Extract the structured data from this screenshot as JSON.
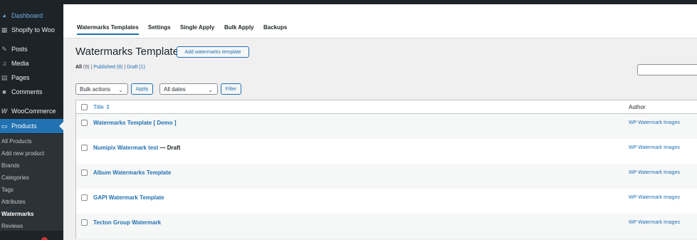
{
  "sidebar": {
    "menu": [
      {
        "label": "Dashboard",
        "icon": "dashboard-icon"
      },
      {
        "label": "Shopify to Woo",
        "icon": "store-icon"
      },
      {
        "label": "Posts",
        "icon": "pin-icon"
      },
      {
        "label": "Media",
        "icon": "media-icon"
      },
      {
        "label": "Pages",
        "icon": "page-icon"
      },
      {
        "label": "Comments",
        "icon": "comment-icon"
      },
      {
        "label": "WooCommerce",
        "icon": "woo-icon"
      },
      {
        "label": "Products",
        "icon": "archive-icon"
      }
    ],
    "submenu": [
      "All Products",
      "Add new product",
      "Brands",
      "Categories",
      "Tags",
      "Attributes",
      "Watermarks",
      "Reviews"
    ]
  },
  "tabs": [
    "Watermarks Templates",
    "Settings",
    "Single Apply",
    "Bulk Apply",
    "Backups"
  ],
  "page": {
    "title": "Watermarks Templates",
    "add_button": "Add watermarks template"
  },
  "filters": {
    "all": "All",
    "all_count": "(9)",
    "sep": "|",
    "published": "Published (8)",
    "draft": "Draft (1)"
  },
  "toolbar": {
    "bulk_actions": "Bulk actions",
    "apply": "Apply",
    "dates": "All dates",
    "filter": "Filter"
  },
  "table": {
    "columns": {
      "title": "Title",
      "sort_icon": "⇕",
      "author": "Author"
    },
    "rows": [
      {
        "title": "Watermarks Template [ Demo ]",
        "state": "",
        "author": "WP Watermark Images"
      },
      {
        "title": "Numipix Watermark test",
        "state": "— Draft",
        "author": "WP Watermark Images"
      },
      {
        "title": "Album Watermarks Template",
        "state": "",
        "author": "WP Watermark Images"
      },
      {
        "title": "GAPI Watermark Template",
        "state": "",
        "author": "WP Watermark Images"
      },
      {
        "title": "Tecton Group Watermark",
        "state": "",
        "author": "WP Watermark Images"
      }
    ]
  },
  "colors": {
    "accent": "#2271b1",
    "sidebar": "#1d2327",
    "badge": "#d63638"
  }
}
